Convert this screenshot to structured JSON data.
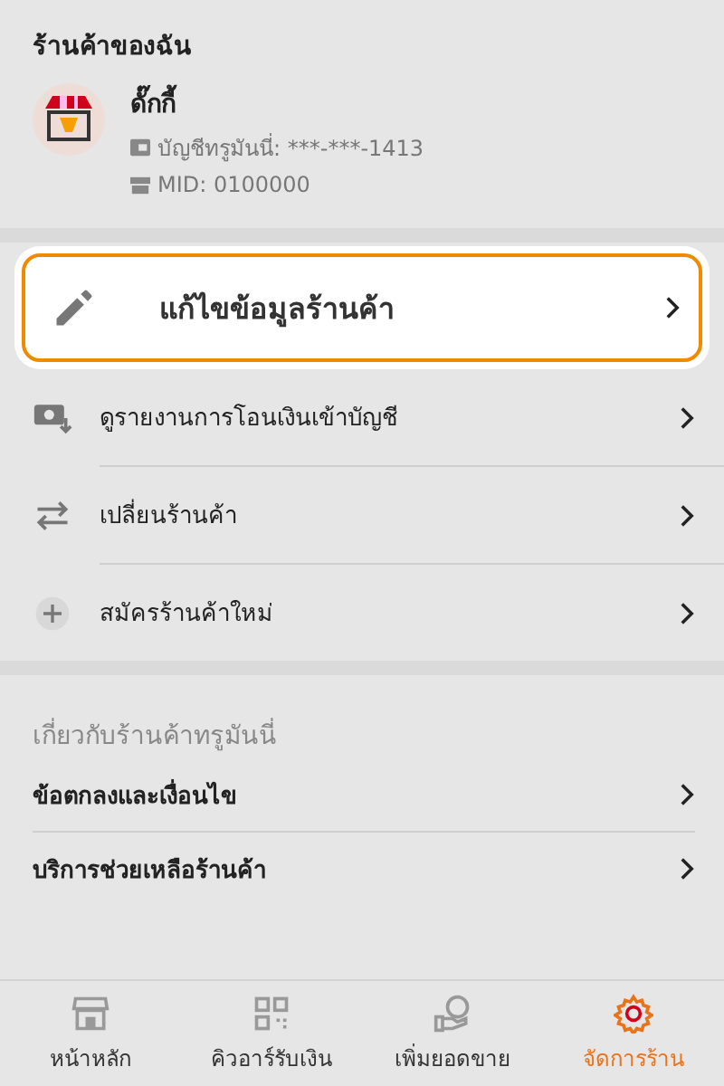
{
  "store": {
    "heading": "ร้านค้าของฉัน",
    "name": "ดั๊กกี้",
    "account": "บัญชีทรูมันนี่: ***-***-1413",
    "mid": "MID: 0100000"
  },
  "highlighted_item": {
    "label": "แก้ไขข้อมูลร้านค้า"
  },
  "menu_items": [
    {
      "label": "ดูรายงานการโอนเงินเข้าบัญชี"
    },
    {
      "label": "เปลี่ยนร้านค้า"
    },
    {
      "label": "สมัครร้านค้าใหม่"
    }
  ],
  "about": {
    "heading": "เกี่ยวกับร้านค้าทรูมันนี่",
    "items": [
      {
        "label": "ข้อตกลงและเงื่อนไข"
      },
      {
        "label": "บริการช่วยเหลือร้านค้า"
      }
    ]
  },
  "tabs": [
    {
      "label": "หน้าหลัก",
      "selected": false
    },
    {
      "label": "คิวอาร์รับเงิน",
      "selected": false
    },
    {
      "label": "เพิ่มยอดขาย",
      "selected": false
    },
    {
      "label": "จัดการร้าน",
      "selected": true
    }
  ]
}
